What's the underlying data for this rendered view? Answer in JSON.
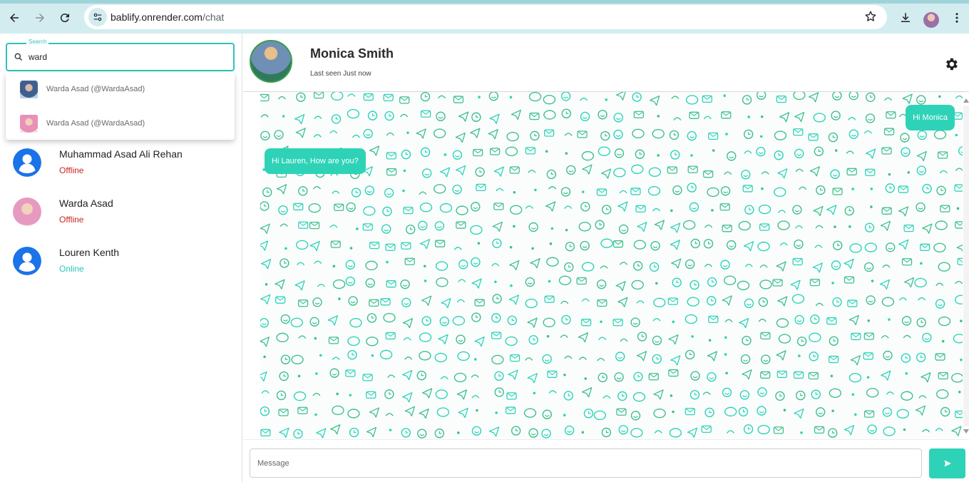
{
  "browser": {
    "url_host": "bablify.onrender.com",
    "url_path": "/chat"
  },
  "sidebar": {
    "search": {
      "legend": "Search",
      "value": "ward"
    },
    "suggestions": [
      {
        "label": "Warda Asad (@WardaAsad)"
      },
      {
        "label": "Warda Asad (@WardaAsad)"
      }
    ],
    "contacts": [
      {
        "name": "Muhammad Asad Ali Rehan",
        "status": "Offline"
      },
      {
        "name": "Warda Asad",
        "status": "Offline"
      },
      {
        "name": "Louren Kenth",
        "status": "Online"
      }
    ]
  },
  "chat": {
    "name": "Monica Smith",
    "last_seen": "Last seen Just now",
    "messages": [
      {
        "direction": "incoming",
        "text": "Hi Lauren, How are you?"
      },
      {
        "direction": "outgoing",
        "text": "Hi Monica"
      }
    ],
    "composer_placeholder": "Message"
  },
  "colors": {
    "accent": "#2ed3b7",
    "offline": "#c62828",
    "online": "#2ec4b6",
    "browser_bar": "#d3ecef"
  },
  "icons": [
    "back-icon",
    "forward-icon",
    "reload-icon",
    "site-settings-icon",
    "star-icon",
    "download-icon",
    "menu-icon",
    "search-icon",
    "gear-icon",
    "send-icon"
  ]
}
